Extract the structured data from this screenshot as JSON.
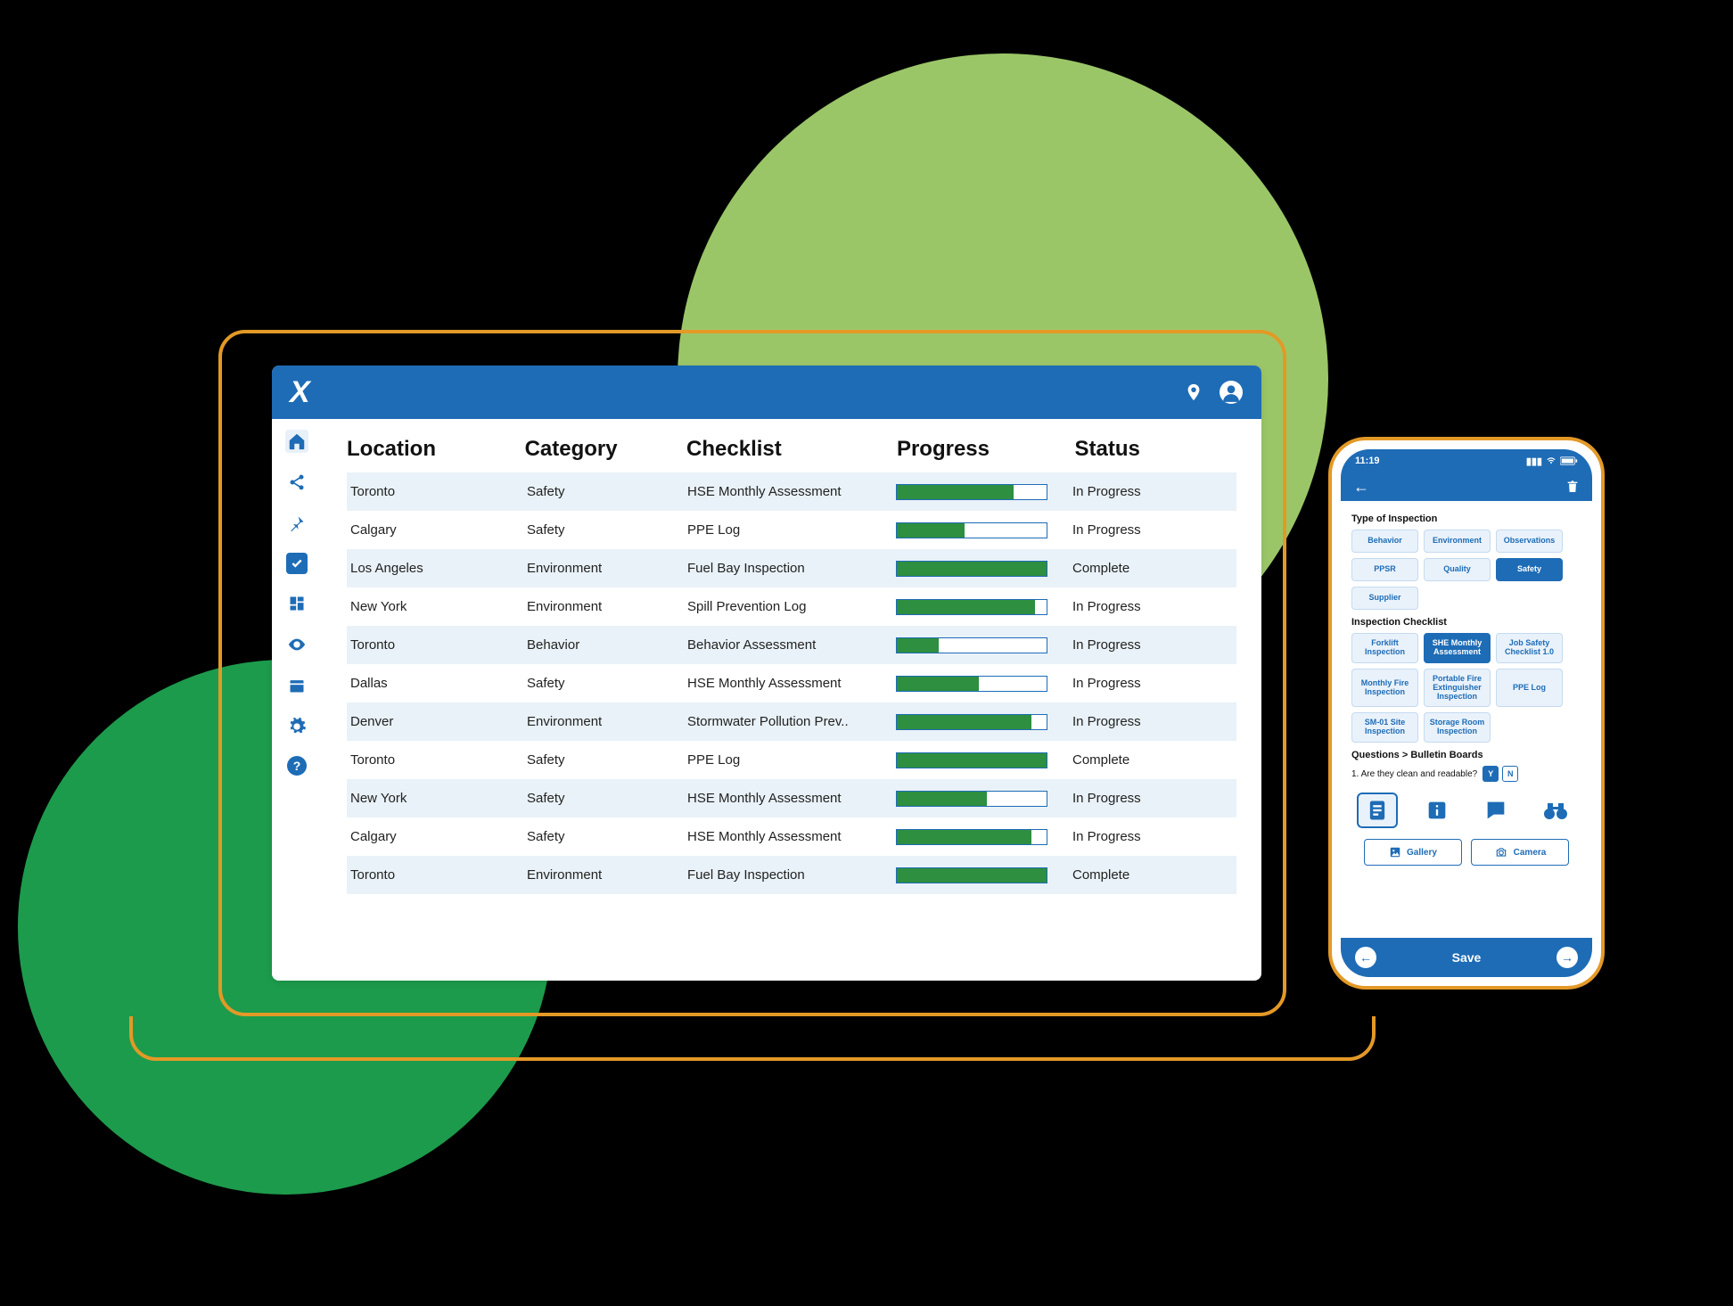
{
  "colors": {
    "accent": "#1E6CB6",
    "green": "#2D8F3F"
  },
  "desktop": {
    "logo": "X",
    "columns": [
      "Location",
      "Category",
      "Checklist",
      "Progress",
      "Status"
    ],
    "rows": [
      {
        "location": "Toronto",
        "category": "Safety",
        "checklist": "HSE Monthly Assessment",
        "progress": 78,
        "status": "In Progress"
      },
      {
        "location": "Calgary",
        "category": "Safety",
        "checklist": "PPE Log",
        "progress": 45,
        "status": "In Progress"
      },
      {
        "location": "Los Angeles",
        "category": "Environment",
        "checklist": "Fuel Bay Inspection",
        "progress": 100,
        "status": "Complete"
      },
      {
        "location": "New York",
        "category": "Environment",
        "checklist": "Spill Prevention Log",
        "progress": 92,
        "status": "In Progress"
      },
      {
        "location": "Toronto",
        "category": "Behavior",
        "checklist": "Behavior Assessment",
        "progress": 28,
        "status": "In Progress"
      },
      {
        "location": "Dallas",
        "category": "Safety",
        "checklist": "HSE Monthly Assessment",
        "progress": 55,
        "status": "In Progress"
      },
      {
        "location": "Denver",
        "category": "Environment",
        "checklist": "Stormwater Pollution Prev..",
        "progress": 90,
        "status": "In Progress"
      },
      {
        "location": "Toronto",
        "category": "Safety",
        "checklist": "PPE Log",
        "progress": 100,
        "status": "Complete"
      },
      {
        "location": "New York",
        "category": "Safety",
        "checklist": "HSE Monthly Assessment",
        "progress": 60,
        "status": "In Progress"
      },
      {
        "location": "Calgary",
        "category": "Safety",
        "checklist": "HSE Monthly Assessment",
        "progress": 90,
        "status": "In Progress"
      },
      {
        "location": "Toronto",
        "category": "Environment",
        "checklist": "Fuel Bay Inspection",
        "progress": 100,
        "status": "Complete"
      }
    ]
  },
  "phone": {
    "time": "11:19",
    "section1_label": "Type of Inspection",
    "type_chips": [
      {
        "label": "Behavior",
        "selected": false
      },
      {
        "label": "Environment",
        "selected": false
      },
      {
        "label": "Observations",
        "selected": false
      },
      {
        "label": "PPSR",
        "selected": false
      },
      {
        "label": "Quality",
        "selected": false
      },
      {
        "label": "Safety",
        "selected": true
      },
      {
        "label": "Supplier",
        "selected": false
      }
    ],
    "section2_label": "Inspection Checklist",
    "checklist_chips": [
      {
        "label": "Forklift Inspection",
        "selected": false
      },
      {
        "label": "SHE Monthly Assessment",
        "selected": true
      },
      {
        "label": "Job Safety Checklist 1.0",
        "selected": false
      },
      {
        "label": "Monthly Fire Inspection",
        "selected": false
      },
      {
        "label": "Portable Fire Extinguisher Inspection",
        "selected": false
      },
      {
        "label": "PPE Log",
        "selected": false
      },
      {
        "label": "SM-01 Site Inspection",
        "selected": false
      },
      {
        "label": "Storage Room Inspection",
        "selected": false
      }
    ],
    "questions_label": "Questions > Bulletin Boards",
    "question_text": "1. Are they clean and readable?",
    "yes_label": "Y",
    "no_label": "N",
    "gallery_label": "Gallery",
    "camera_label": "Camera",
    "save_label": "Save"
  }
}
